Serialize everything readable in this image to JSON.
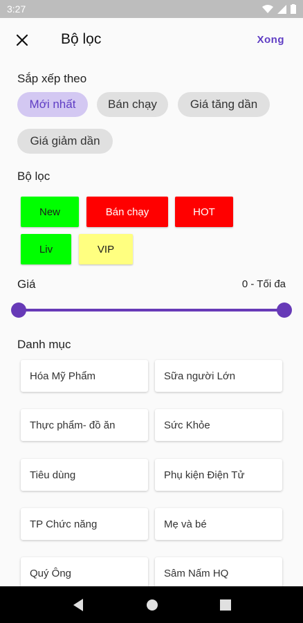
{
  "status_bar": {
    "time": "3:27"
  },
  "header": {
    "title": "Bộ lọc",
    "done_label": "Xong"
  },
  "sort": {
    "label": "Sắp xếp theo",
    "options": [
      "Mới nhất",
      "Bán chạy",
      "Giá tăng dần",
      "Giá giảm dần"
    ],
    "selected": "Mới nhất"
  },
  "filter": {
    "label": "Bộ lọc",
    "tags": [
      {
        "label": "New",
        "bg": "#00ff00",
        "fg": "#1b1b1b"
      },
      {
        "label": "Bán chạy",
        "bg": "#ff0000",
        "fg": "#ffffff"
      },
      {
        "label": "HOT",
        "bg": "#ff0000",
        "fg": "#ffffff"
      },
      {
        "label": "Liv",
        "bg": "#00ff00",
        "fg": "#1b1b1b"
      },
      {
        "label": "VIP",
        "bg": "#ffff80",
        "fg": "#1b1b1b"
      }
    ]
  },
  "price": {
    "label": "Giá",
    "range_text": "0 - Tối đa",
    "min_fraction": 0,
    "max_fraction": 1
  },
  "category": {
    "label": "Danh mục",
    "items": [
      "Hóa Mỹ Phẩm",
      "Sữa người Lớn",
      "Thực phẩm- đồ ăn",
      "Sức Khỏe",
      "Tiêu dùng",
      "Phụ kiện Điện Tử",
      "TP Chức năng",
      "Mẹ và bé",
      "Quý Ông",
      "Sâm Nấm HQ"
    ]
  },
  "colors": {
    "accent": "#673ab7",
    "chip_selected_bg": "#d3c8f2",
    "chip_bg": "#e0e0e0"
  }
}
